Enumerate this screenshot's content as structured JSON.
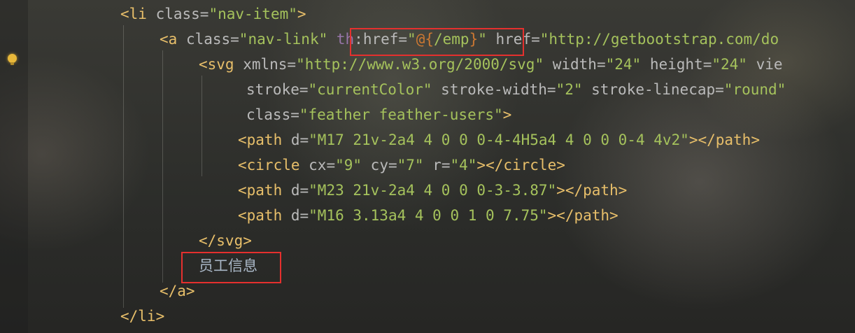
{
  "editor": {
    "lines": [
      {
        "indent": 0,
        "tokens": [
          {
            "t": "tag",
            "v": "<li "
          },
          {
            "t": "attr",
            "v": "class="
          },
          {
            "t": "str",
            "v": "\"nav-item\""
          },
          {
            "t": "tag",
            "v": ">"
          }
        ]
      },
      {
        "indent": 1,
        "tokens": [
          {
            "t": "tag",
            "v": "<a "
          },
          {
            "t": "attr",
            "v": "class="
          },
          {
            "t": "str",
            "v": "\"nav-link\" "
          },
          {
            "t": "th",
            "v": "th"
          },
          {
            "t": "attr",
            "v": ":href="
          },
          {
            "t": "str",
            "v": "\""
          },
          {
            "t": "expr",
            "v": "@{"
          },
          {
            "t": "str",
            "v": "/emp"
          },
          {
            "t": "expr",
            "v": "}"
          },
          {
            "t": "str",
            "v": "\""
          },
          {
            "t": "attr",
            "v": " href="
          },
          {
            "t": "str",
            "v": "\"http://getbootstrap.com/do"
          }
        ]
      },
      {
        "indent": 2,
        "tokens": [
          {
            "t": "tag",
            "v": "<svg "
          },
          {
            "t": "attr",
            "v": "xmlns="
          },
          {
            "t": "str",
            "v": "\"http://www.w3.org/2000/svg\""
          },
          {
            "t": "attr",
            "v": " width="
          },
          {
            "t": "str",
            "v": "\"24\""
          },
          {
            "t": "attr",
            "v": " height="
          },
          {
            "t": "str",
            "v": "\"24\""
          },
          {
            "t": "attr",
            "v": " vie"
          }
        ]
      },
      {
        "indent": 3,
        "tokens": [
          {
            "t": "attr",
            "v": "stroke="
          },
          {
            "t": "str",
            "v": "\"currentColor\""
          },
          {
            "t": "attr",
            "v": " stroke-width="
          },
          {
            "t": "str",
            "v": "\"2\""
          },
          {
            "t": "attr",
            "v": " stroke-linecap="
          },
          {
            "t": "str",
            "v": "\"round\""
          }
        ]
      },
      {
        "indent": 3,
        "tokens": [
          {
            "t": "attr",
            "v": "class="
          },
          {
            "t": "str",
            "v": "\"feather feather-users\""
          },
          {
            "t": "tag",
            "v": ">"
          }
        ]
      },
      {
        "indent": 4,
        "tokens": [
          {
            "t": "tag",
            "v": "<path "
          },
          {
            "t": "attr",
            "v": "d="
          },
          {
            "t": "str",
            "v": "\"M17 21v-2a4 4 0 0 0-4-4H5a4 4 0 0 0-4 4v2\""
          },
          {
            "t": "tag",
            "v": "></path>"
          }
        ]
      },
      {
        "indent": 4,
        "tokens": [
          {
            "t": "tag",
            "v": "<circle "
          },
          {
            "t": "attr",
            "v": "cx="
          },
          {
            "t": "str",
            "v": "\"9\""
          },
          {
            "t": "attr",
            "v": " cy="
          },
          {
            "t": "str",
            "v": "\"7\""
          },
          {
            "t": "attr",
            "v": " r="
          },
          {
            "t": "str",
            "v": "\"4\""
          },
          {
            "t": "tag",
            "v": "></circle>"
          }
        ]
      },
      {
        "indent": 4,
        "tokens": [
          {
            "t": "tag",
            "v": "<path "
          },
          {
            "t": "attr",
            "v": "d="
          },
          {
            "t": "str",
            "v": "\"M23 21v-2a4 4 0 0 0-3-3.87\""
          },
          {
            "t": "tag",
            "v": "></path>"
          }
        ]
      },
      {
        "indent": 4,
        "tokens": [
          {
            "t": "tag",
            "v": "<path "
          },
          {
            "t": "attr",
            "v": "d="
          },
          {
            "t": "str",
            "v": "\"M16 3.13a4 4 0 0 1 0 7.75\""
          },
          {
            "t": "tag",
            "v": "></path>"
          }
        ]
      },
      {
        "indent": 2,
        "tokens": [
          {
            "t": "tag",
            "v": "</svg>"
          }
        ]
      },
      {
        "indent": 2,
        "tokens": [
          {
            "t": "txt",
            "v": "员工信息"
          }
        ]
      },
      {
        "indent": 1,
        "tokens": [
          {
            "t": "tag",
            "v": "</a>"
          }
        ]
      },
      {
        "indent": 0,
        "tokens": [
          {
            "t": "tag",
            "v": "</li>"
          }
        ]
      }
    ]
  },
  "colors": {
    "tag": "#e8bf6a",
    "attribute": "#bababa",
    "string": "#a5c25c",
    "thymeleaf_namespace": "#9876aa",
    "expression_brace": "#cc7832",
    "text": "#a9b7c6",
    "highlight_box": "#e5302e"
  },
  "icons": [
    "intention-bulb-icon"
  ]
}
